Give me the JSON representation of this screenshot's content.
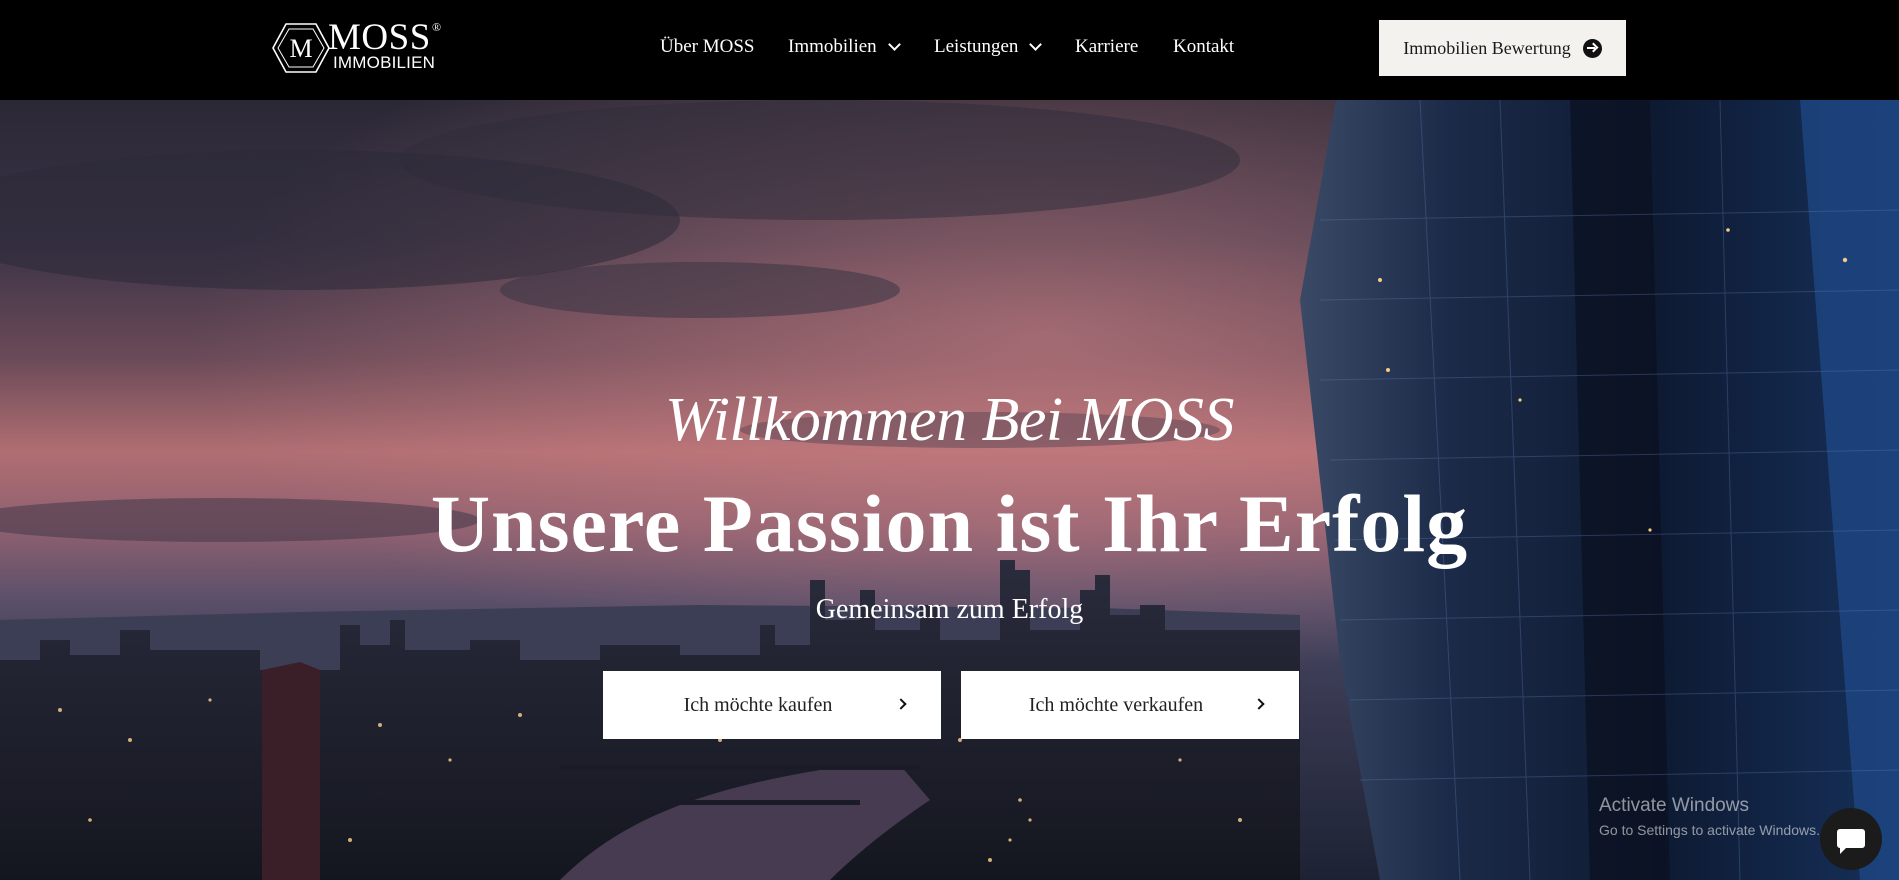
{
  "header": {
    "logo": {
      "letter": "M",
      "word": "MOSS",
      "registered": "®",
      "sub": "IMMOBILIEN"
    },
    "nav": [
      {
        "label": "Über MOSS",
        "has_dropdown": false
      },
      {
        "label": "Immobilien",
        "has_dropdown": true
      },
      {
        "label": "Leistungen",
        "has_dropdown": true
      },
      {
        "label": "Karriere",
        "has_dropdown": false
      },
      {
        "label": "Kontakt",
        "has_dropdown": false
      }
    ],
    "cta": {
      "label": "Immobilien Bewertung",
      "icon": "arrow-circle-right-icon"
    }
  },
  "hero": {
    "kicker": "Willkommen Bei MOSS",
    "headline": "Unsere Passion ist Ihr Erfolg",
    "subline": "Gemeinsam zum Erfolg",
    "buttons": [
      {
        "label": "Ich möchte kaufen",
        "icon": "chevron-right-icon"
      },
      {
        "label": "Ich möchte verkaufen",
        "icon": "chevron-right-icon"
      }
    ]
  },
  "watermark": {
    "title": "Activate Windows",
    "subtitle": "Go to Settings to activate Windows."
  },
  "chat": {
    "icon": "chat-bubble-icon"
  },
  "colors": {
    "header_bg": "#000000",
    "cta_bg": "#f3f2ee",
    "button_bg": "#ffffff",
    "text_light": "#ffffff"
  }
}
